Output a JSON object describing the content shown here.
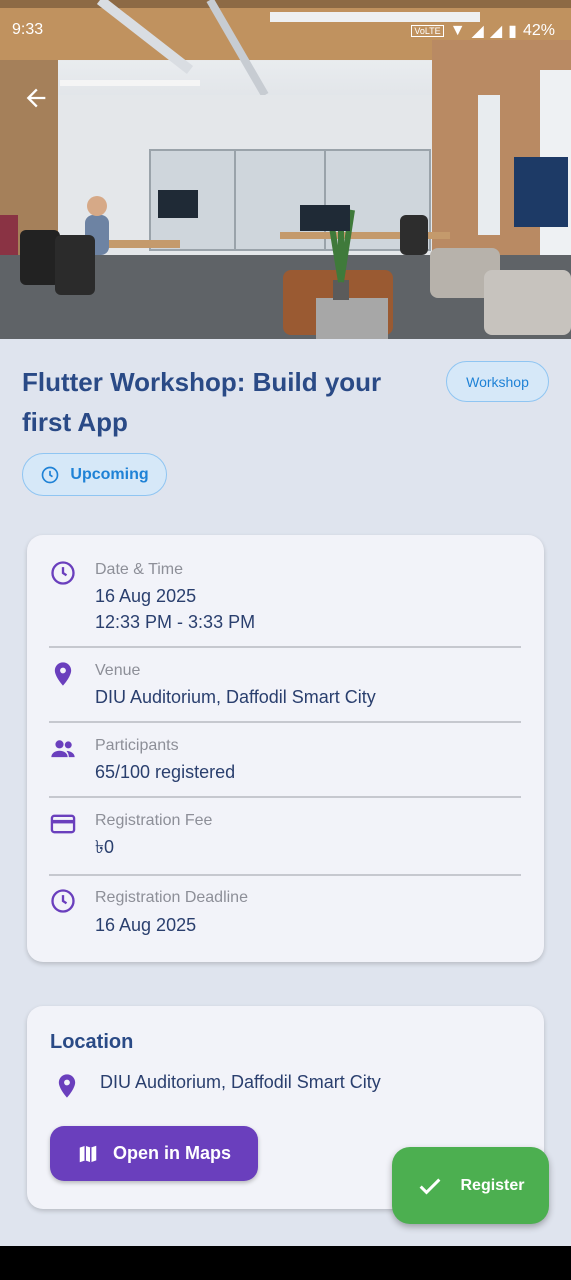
{
  "status_bar": {
    "time": "9:33",
    "battery": "42%",
    "network_label": "VoLTE"
  },
  "event": {
    "title": "Flutter Workshop: Build your first App",
    "category": "Workshop",
    "status": "Upcoming"
  },
  "details": {
    "date_time": {
      "label": "Date & Time",
      "date": "16 Aug 2025",
      "time": "12:33 PM - 3:33 PM"
    },
    "venue": {
      "label": "Venue",
      "value": "DIU Auditorium, Daffodil Smart City"
    },
    "participants": {
      "label": "Participants",
      "value": "65/100 registered"
    },
    "fee": {
      "label": "Registration Fee",
      "value": "৳0"
    },
    "deadline": {
      "label": "Registration Deadline",
      "value": "16 Aug 2025"
    }
  },
  "location": {
    "title": "Location",
    "address": "DIU Auditorium, Daffodil Smart City",
    "maps_button": "Open in Maps"
  },
  "register_button": "Register",
  "colors": {
    "accent": "#6a3fbd",
    "title": "#2a4a86",
    "chip": "#1f82d6",
    "register": "#4caf50"
  }
}
